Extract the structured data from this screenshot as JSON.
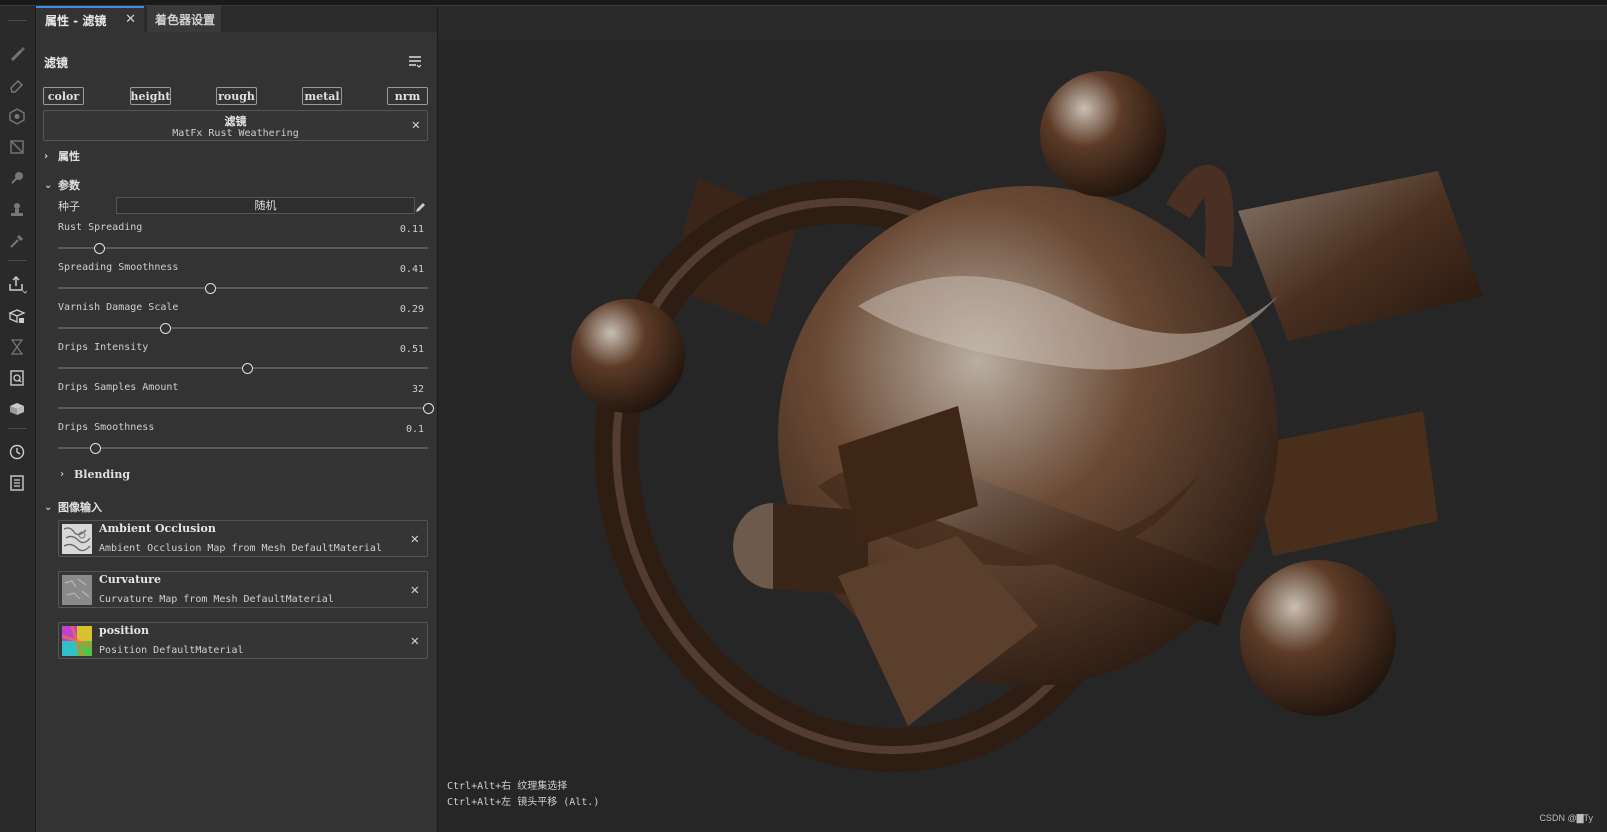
{
  "tabs": {
    "active_label": "属性 - 滤镜",
    "second_label": "着色器设置"
  },
  "panel": {
    "filter_title": "滤镜",
    "channels": [
      "color",
      "height",
      "rough",
      "metal",
      "nrm"
    ],
    "filter_box": {
      "name": "滤镜",
      "subtitle": "MatFx Rust Weathering"
    },
    "sections": {
      "properties": "属性",
      "parameters": "参数",
      "blending": "Blending",
      "image_inputs": "图像输入"
    },
    "seed": {
      "label": "种子",
      "value": "随机"
    },
    "params": [
      {
        "label": "Rust Spreading",
        "value": "0.11",
        "fraction": 0.11
      },
      {
        "label": "Spreading Smoothness",
        "value": "0.41",
        "fraction": 0.41
      },
      {
        "label": "Varnish Damage Scale",
        "value": "0.29",
        "fraction": 0.29
      },
      {
        "label": "Drips Intensity",
        "value": "0.51",
        "fraction": 0.51
      },
      {
        "label": "Drips Samples Amount",
        "value": "32",
        "fraction": 1.0
      },
      {
        "label": "Drips Smoothness",
        "value": "0.1",
        "fraction": 0.1
      }
    ],
    "image_inputs": [
      {
        "title": "Ambient Occlusion",
        "subtitle": "Ambient Occlusion Map from Mesh DefaultMaterial"
      },
      {
        "title": "Curvature",
        "subtitle": "Curvature Map from Mesh DefaultMaterial"
      },
      {
        "title": "position",
        "subtitle": "Position DefaultMaterial"
      }
    ]
  },
  "viewport": {
    "hint_1": "Ctrl+Alt+右 纹理集选择",
    "hint_2": "Ctrl+Alt+左 镜头平移 (Alt.)",
    "watermark": "CSDN @▇Ty"
  },
  "colors": {
    "accent": "#3d8eea",
    "panel_bg": "#333333",
    "viewport_bg": "#262626"
  }
}
